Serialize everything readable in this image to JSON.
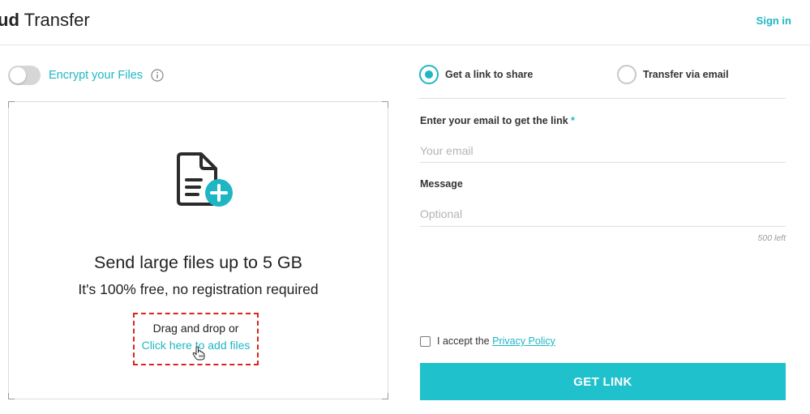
{
  "header": {
    "brand_bold": "ud",
    "brand_light": " Transfer",
    "signin_label": "Sign in"
  },
  "encrypt": {
    "label": "Encrypt your Files",
    "enabled": false
  },
  "dropzone": {
    "title": "Send large files up to 5 GB",
    "subtitle": "It's 100% free, no registration required",
    "drag_text": "Drag and drop or",
    "click_text": "Click here to add files"
  },
  "share_mode": {
    "options": [
      {
        "label": "Get a link to share",
        "selected": true
      },
      {
        "label": "Transfer via email",
        "selected": false
      }
    ]
  },
  "form": {
    "email_label": "Enter your email to get the link",
    "required_mark": "*",
    "email_placeholder": "Your email",
    "message_label": "Message",
    "message_placeholder": "Optional",
    "char_count": "500 left",
    "accept_prefix": "I accept the ",
    "privacy_link": "Privacy Policy",
    "submit_label": "GET LINK"
  },
  "colors": {
    "accent": "#1fb6c4",
    "button": "#1fc1cc",
    "highlight": "#d9251c"
  },
  "icons": [
    "info-icon",
    "file-add-icon",
    "hand-cursor-icon"
  ]
}
